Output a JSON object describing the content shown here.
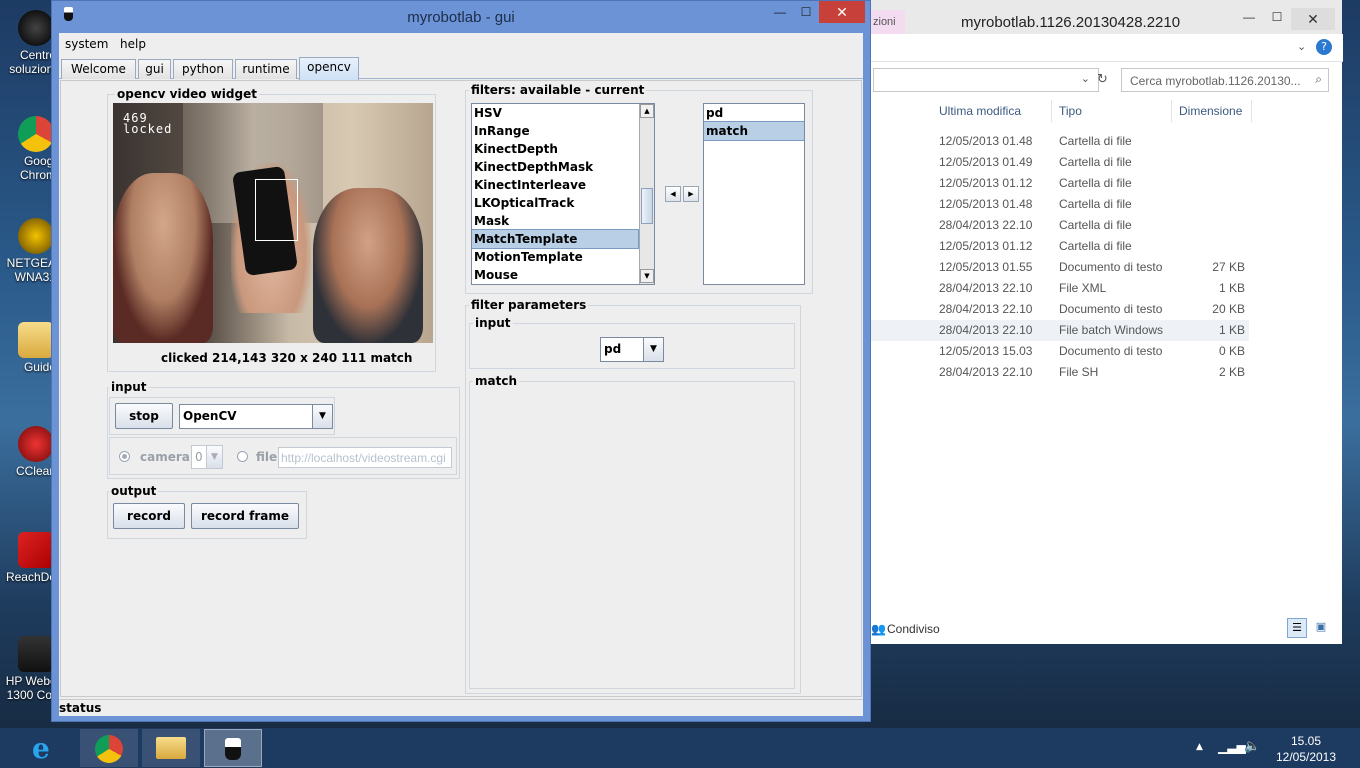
{
  "desktop": {
    "icons": [
      {
        "label_1": "Centro",
        "label_2": "soluzioni",
        "icon": "hp-logo-icon"
      },
      {
        "label_1": "Googl",
        "label_2": "Chrom",
        "icon": "chrome-icon"
      },
      {
        "label_1": "NETGEA",
        "label_2": "WNA31",
        "icon": "netgear-icon"
      },
      {
        "label_1": "Guido",
        "label_2": "",
        "icon": "folder-icon"
      },
      {
        "label_1": "CClean",
        "label_2": "",
        "icon": "ccleaner-icon"
      },
      {
        "label_1": "ReachDe",
        "label_2": "",
        "icon": "reach-icon"
      },
      {
        "label_1": "HP Webc",
        "label_2": "1300 Cor",
        "icon": "webcam-icon"
      }
    ]
  },
  "explorer": {
    "tab_fragment": "zioni",
    "title": "myrobotlab.1126.20130428.2210",
    "search_placeholder": "Cerca myrobotlab.1126.20130...",
    "columns": {
      "modified": "Ultima modifica",
      "type": "Tipo",
      "size": "Dimensione"
    },
    "rows": [
      {
        "modified": "12/05/2013 01.48",
        "type": "Cartella di file",
        "size": ""
      },
      {
        "modified": "12/05/2013 01.49",
        "type": "Cartella di file",
        "size": ""
      },
      {
        "modified": "12/05/2013 01.12",
        "type": "Cartella di file",
        "size": ""
      },
      {
        "modified": "12/05/2013 01.48",
        "type": "Cartella di file",
        "size": ""
      },
      {
        "modified": "28/04/2013 22.10",
        "type": "Cartella di file",
        "size": ""
      },
      {
        "modified": "12/05/2013 01.12",
        "type": "Cartella di file",
        "size": ""
      },
      {
        "modified": "12/05/2013 01.55",
        "type": "Documento di testo",
        "size": "27 KB"
      },
      {
        "modified": "28/04/2013 22.10",
        "type": "File XML",
        "size": "1 KB"
      },
      {
        "modified": "28/04/2013 22.10",
        "type": "Documento di testo",
        "size": "20 KB"
      },
      {
        "modified": "28/04/2013 22.10",
        "type": "File batch Windows",
        "size": "1 KB"
      },
      {
        "modified": "12/05/2013 15.03",
        "type": "Documento di testo",
        "size": "0 KB"
      },
      {
        "modified": "28/04/2013 22.10",
        "type": "File SH",
        "size": "2 KB"
      }
    ],
    "shared_label": "Condiviso"
  },
  "gui": {
    "title": "myrobotlab - gui",
    "close_glyph": "✕",
    "menu": {
      "system": "system",
      "help": "help"
    },
    "tabs": [
      "Welcome",
      "gui",
      "python",
      "runtime",
      "opencv"
    ],
    "video": {
      "group_label": "opencv  video widget",
      "overlay_line1": "469",
      "overlay_line2": "locked",
      "info": "clicked 214,143  320 x 240  111  match"
    },
    "input": {
      "group_label": "input",
      "stop_label": "stop",
      "source_value": "OpenCV",
      "camera_label": "camera",
      "camera_index": "0",
      "file_label": "file",
      "url_value": "http://localhost/videostream.cgi"
    },
    "output": {
      "group_label": "output",
      "record_label": "record",
      "record_frame_label": "record frame"
    },
    "filters": {
      "group_label": "filters: available - current",
      "available": [
        "HSV",
        "InRange",
        "KinectDepth",
        "KinectDepthMask",
        "KinectInterleave",
        "LKOpticalTrack",
        "Mask",
        "MatchTemplate",
        "MotionTemplate",
        "Mouse"
      ],
      "selected_available": "MatchTemplate",
      "current": [
        "pd",
        "match"
      ],
      "selected_current": "match"
    },
    "filter_parameters": {
      "group_label": "filter parameters",
      "input_label": "input",
      "input_value": "pd",
      "match_label": "match"
    },
    "status": "status"
  },
  "taskbar": {
    "clock_time": "15.05",
    "clock_date": "12/05/2013"
  }
}
